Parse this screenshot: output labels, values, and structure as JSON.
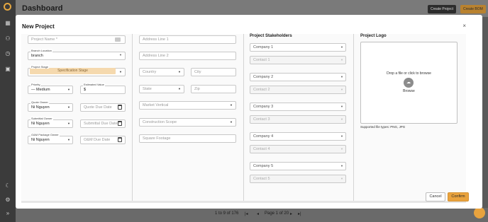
{
  "app": {
    "title": "Dashboard",
    "create_project": "Create Project",
    "create_bom": "Create BOM"
  },
  "pagination": {
    "range": "1 to 9 of 176",
    "page_label": "Page 1 of 20"
  },
  "modal": {
    "title": "New Project",
    "close": "×",
    "col1": {
      "project_name_placeholder": "Project Name *",
      "branch_label": "Branch Location",
      "branch_value": "branch",
      "stage_label": "Project Stage",
      "stage_value": "Specification Stage",
      "priority_label": "Priority",
      "priority_value": "— Medium",
      "estimated_label": "Estimated Value",
      "estimated_value": "$",
      "quote_owner_label": "Quote Owner",
      "quote_owner_value": "Ni Nguyen",
      "quote_due_placeholder": "Quote Due Date",
      "submittal_owner_label": "Submittal Owner",
      "submittal_owner_value": "Ni Nguyen",
      "submittal_due_placeholder": "Submittal Due Date",
      "om_owner_label": "O&M Package Owner",
      "om_owner_value": "Ni Nguyen",
      "om_due_placeholder": "O&M Due Date"
    },
    "col2": {
      "address1": "Address Line 1",
      "address2": "Address Line 2",
      "country": "Country",
      "city": "City",
      "state": "State",
      "zip": "Zip",
      "market": "Market Vertical",
      "construction": "Construction Scope",
      "sqft": "Square Footage"
    },
    "col3": {
      "heading": "Project Stakeholders",
      "companies": [
        "Company 1",
        "Company 2",
        "Company 3",
        "Company 4",
        "Company 5"
      ],
      "contacts": [
        "Contact 1",
        "Contact 2",
        "Contact 3",
        "Contact 4",
        "Contact 5"
      ]
    },
    "col4": {
      "heading": "Project Logo",
      "drop_text": "Drop a file or click to browse",
      "browse": "Browse",
      "supported": "Supported file types: PNG, JPG"
    },
    "cancel": "Cancel",
    "confirm": "Confirm"
  },
  "colors": {
    "accent": "#e9a33e",
    "stage_bg": "#f5d9ae"
  }
}
